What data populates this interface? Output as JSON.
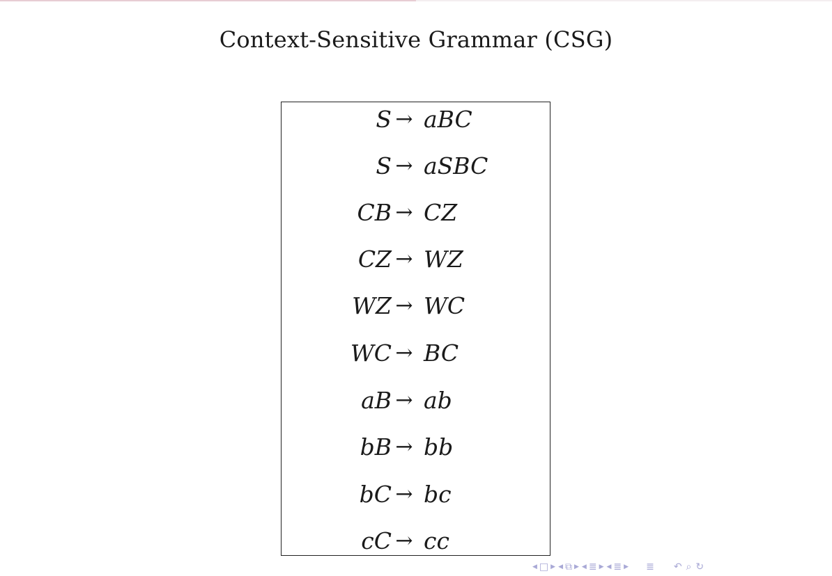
{
  "progress": 0.5,
  "title": "Context-Sensitive Grammar (CSG)",
  "arrow": "→",
  "rules": [
    {
      "lhs": "S",
      "rhs": "aBC"
    },
    {
      "lhs": "S",
      "rhs": "aSBC"
    },
    {
      "lhs": "CB",
      "rhs": "CZ"
    },
    {
      "lhs": "CZ",
      "rhs": "WZ"
    },
    {
      "lhs": "WZ",
      "rhs": "WC"
    },
    {
      "lhs": "WC",
      "rhs": "BC"
    },
    {
      "lhs": "aB",
      "rhs": "ab"
    },
    {
      "lhs": "bB",
      "rhs": "bb"
    },
    {
      "lhs": "bC",
      "rhs": "bc"
    },
    {
      "lhs": "cC",
      "rhs": "cc"
    }
  ],
  "navigation": {
    "icons": [
      "frame-prev-icon",
      "frame-icon",
      "frame-next-icon",
      "subsection-prev-icon",
      "subsection-icon",
      "subsection-next-icon",
      "section-prev-icon",
      "section-icon",
      "section-next-icon",
      "outline-prev-icon",
      "outline-icon",
      "outline-next-icon",
      "appendix-icon",
      "search-icon",
      "zoom-icon",
      "back-forward-icon"
    ],
    "color": "#a9a9d6"
  }
}
